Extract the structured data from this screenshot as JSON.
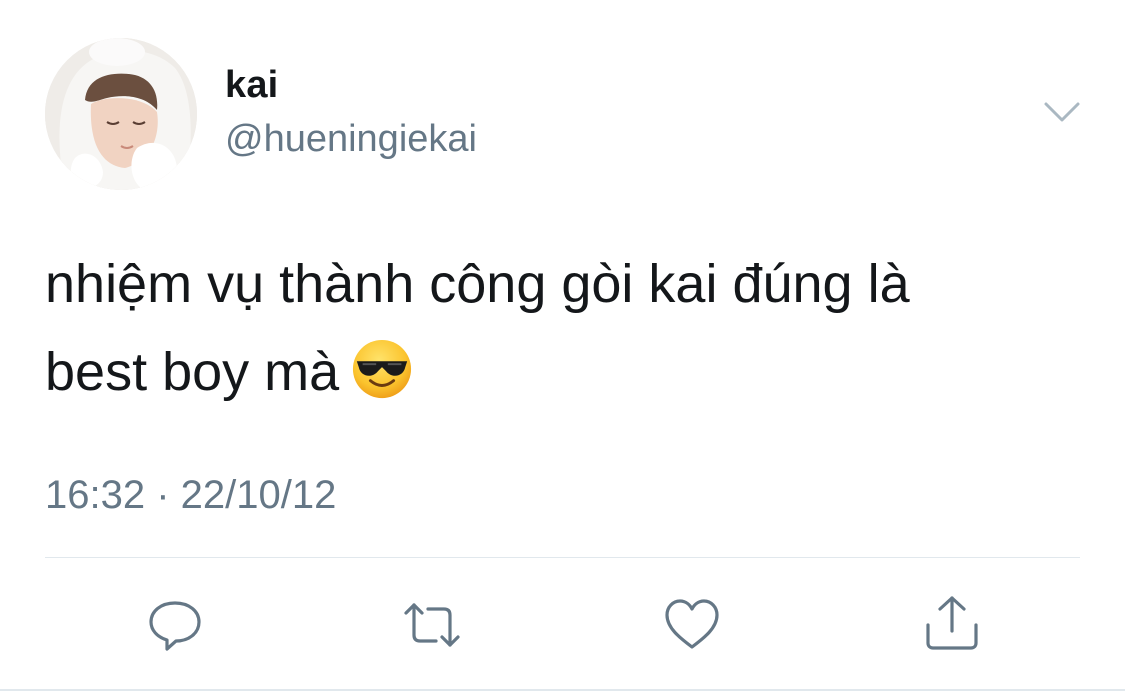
{
  "user": {
    "display_name": "kai",
    "handle": "@hueningiekai"
  },
  "tweet": {
    "text_line1": "nhiệm vụ thành công gòi kai đúng là",
    "text_line2": "best boy mà",
    "emoji": "smiling-face-with-sunglasses",
    "timestamp": "16:32 · 22/10/12"
  },
  "actions": [
    "reply-icon",
    "retweet-icon",
    "like-icon",
    "share-icon"
  ],
  "colors": {
    "text_primary": "#14171a",
    "text_secondary": "#657786",
    "divider": "#e1e8ed"
  }
}
